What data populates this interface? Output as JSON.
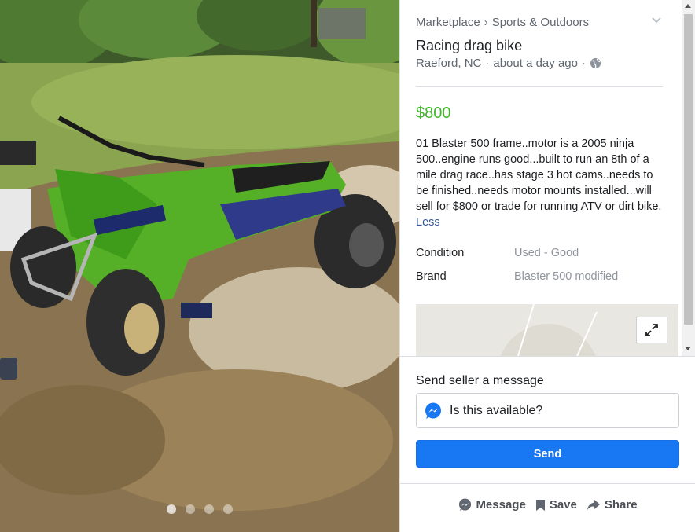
{
  "photo": {
    "carousel_count": 4,
    "active_index": 0
  },
  "breadcrumb": {
    "items": [
      "Marketplace",
      "Sports & Outdoors"
    ],
    "separator": "›"
  },
  "listing": {
    "title": "Racing drag bike",
    "location": "Raeford, NC",
    "time": "about a day ago",
    "meta_separator": "·",
    "price": "$800",
    "description": "01 Blaster 500 frame..motor is a 2005 ninja 500..engine runs good...built to run an 8th of a mile drag race..has stage 3 hot cams..needs to be finished..needs motor mounts installed...will sell for $800 or trade for running ATV or dirt bike.",
    "less_link": "Less",
    "attributes": [
      {
        "label": "Condition",
        "value": "Used - Good"
      },
      {
        "label": "Brand",
        "value": "Blaster 500 modified"
      }
    ]
  },
  "contact": {
    "label": "Send seller a message",
    "message_value": "Is this available?",
    "send_label": "Send"
  },
  "actions": {
    "message_label": "Message",
    "save_label": "Save",
    "share_label": "Share"
  },
  "colors": {
    "price": "#42b72a",
    "send_button": "#1877f2",
    "link": "#385898",
    "muted": "#606770"
  },
  "icons": {
    "globe": "globe-icon",
    "messenger": "messenger-icon",
    "expand": "expand-icon",
    "bookmark": "bookmark-icon",
    "share": "share-icon",
    "chevron": "chevron-down-icon"
  }
}
